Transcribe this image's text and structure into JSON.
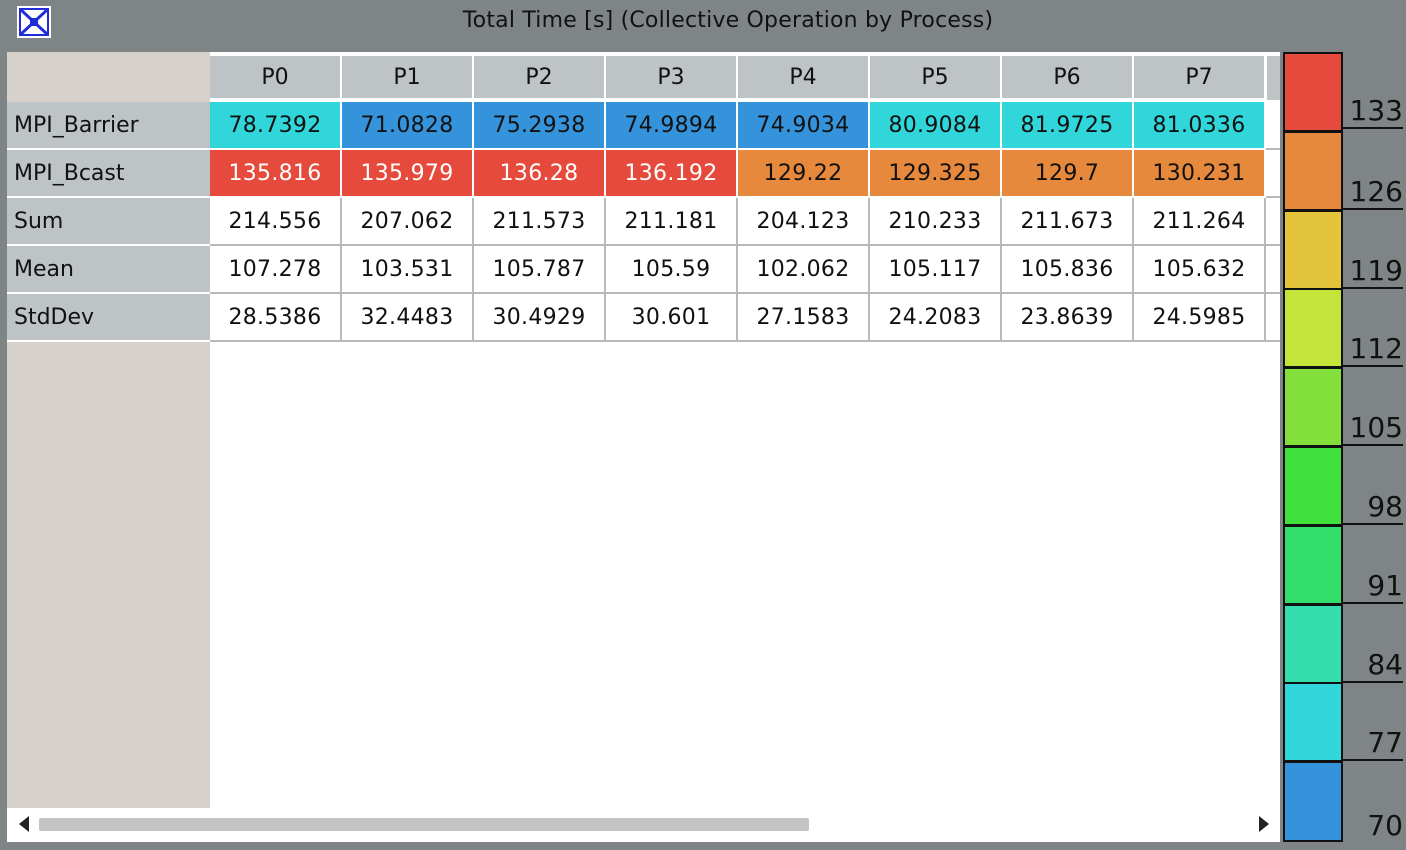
{
  "window": {
    "title": "Total Time [s] (Collective Operation by Process)",
    "icon": "app-grid-icon"
  },
  "table": {
    "columns": [
      "P0",
      "P1",
      "P2",
      "P3",
      "P4",
      "P5",
      "P6",
      "P7"
    ],
    "rows": [
      {
        "label": "MPI_Barrier",
        "values": [
          "78.7392",
          "71.0828",
          "75.2938",
          "74.9894",
          "74.9034",
          "80.9084",
          "81.9725",
          "81.0336"
        ],
        "colors": [
          "#31d6db",
          "#3593db",
          "#3593db",
          "#3593db",
          "#3593db",
          "#31d6db",
          "#31d6db",
          "#31d6db"
        ],
        "text_colors": [
          "#111111",
          "#111111",
          "#111111",
          "#111111",
          "#111111",
          "#111111",
          "#111111",
          "#111111"
        ]
      },
      {
        "label": "MPI_Bcast",
        "values": [
          "135.816",
          "135.979",
          "136.28",
          "136.192",
          "129.22",
          "129.325",
          "129.7",
          "130.231"
        ],
        "colors": [
          "#e64a3d",
          "#e64a3d",
          "#e64a3d",
          "#e64a3d",
          "#e6893d",
          "#e6893d",
          "#e6893d",
          "#e6893d"
        ],
        "text_colors": [
          "#ffffff",
          "#ffffff",
          "#ffffff",
          "#ffffff",
          "#111111",
          "#111111",
          "#111111",
          "#111111"
        ]
      },
      {
        "label": "Sum",
        "values": [
          "214.556",
          "207.062",
          "211.573",
          "211.181",
          "204.123",
          "210.233",
          "211.673",
          "211.264"
        ]
      },
      {
        "label": "Mean",
        "values": [
          "107.278",
          "103.531",
          "105.787",
          "105.59",
          "102.062",
          "105.117",
          "105.836",
          "105.632"
        ]
      },
      {
        "label": "StdDev",
        "values": [
          "28.5386",
          "32.4483",
          "30.4929",
          "30.601",
          "27.1583",
          "24.2083",
          "23.8639",
          "24.5985"
        ]
      }
    ]
  },
  "legend": {
    "labels": [
      "133",
      "126",
      "119",
      "112",
      "105",
      "98",
      "91",
      "84",
      "77",
      "70"
    ],
    "colors": [
      "#e64a3d",
      "#e6893d",
      "#e3c43b",
      "#c4e33b",
      "#83e03b",
      "#3fe03b",
      "#33dd6a",
      "#35dcac",
      "#31d6db",
      "#3593db"
    ]
  },
  "scrollbar": {
    "left_icon": "scroll-left-arrow-icon",
    "right_icon": "scroll-right-arrow-icon"
  }
}
